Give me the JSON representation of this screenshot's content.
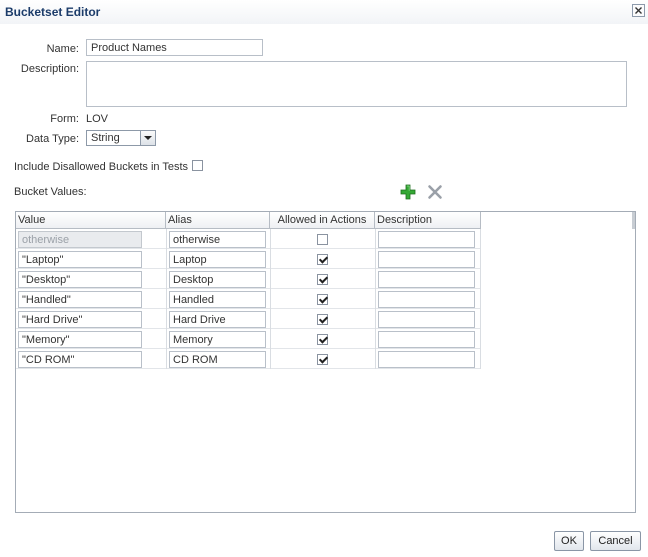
{
  "dialog": {
    "title": "Bucketset Editor"
  },
  "form": {
    "name_label": "Name:",
    "name_value": "Product Names",
    "description_label": "Description:",
    "description_value": "",
    "form_label": "Form:",
    "form_value": "LOV",
    "datatype_label": "Data Type:",
    "datatype_value": "String",
    "include_label": "Include Disallowed Buckets in Tests",
    "include_checked": false,
    "bucket_values_label": "Bucket Values:"
  },
  "toolbar": {
    "add_icon": "plus-icon",
    "delete_icon": "x-icon",
    "add_color": "#2ea12e"
  },
  "table": {
    "headers": [
      "Value",
      "Alias",
      "Allowed in Actions",
      "Description"
    ],
    "rows": [
      {
        "value": "otherwise",
        "alias": "otherwise",
        "allowed": false,
        "description": ""
      },
      {
        "value": "\"Laptop\"",
        "alias": "Laptop",
        "allowed": true,
        "description": ""
      },
      {
        "value": "\"Desktop\"",
        "alias": "Desktop",
        "allowed": true,
        "description": ""
      },
      {
        "value": "\"Handled\"",
        "alias": "Handled",
        "allowed": true,
        "description": ""
      },
      {
        "value": "\"Hard Drive\"",
        "alias": "Hard Drive",
        "allowed": true,
        "description": ""
      },
      {
        "value": "\"Memory\"",
        "alias": "Memory",
        "allowed": true,
        "description": ""
      },
      {
        "value": "\"CD ROM\"",
        "alias": "CD ROM",
        "allowed": true,
        "description": ""
      }
    ]
  },
  "buttons": {
    "ok": "OK",
    "cancel": "Cancel"
  }
}
